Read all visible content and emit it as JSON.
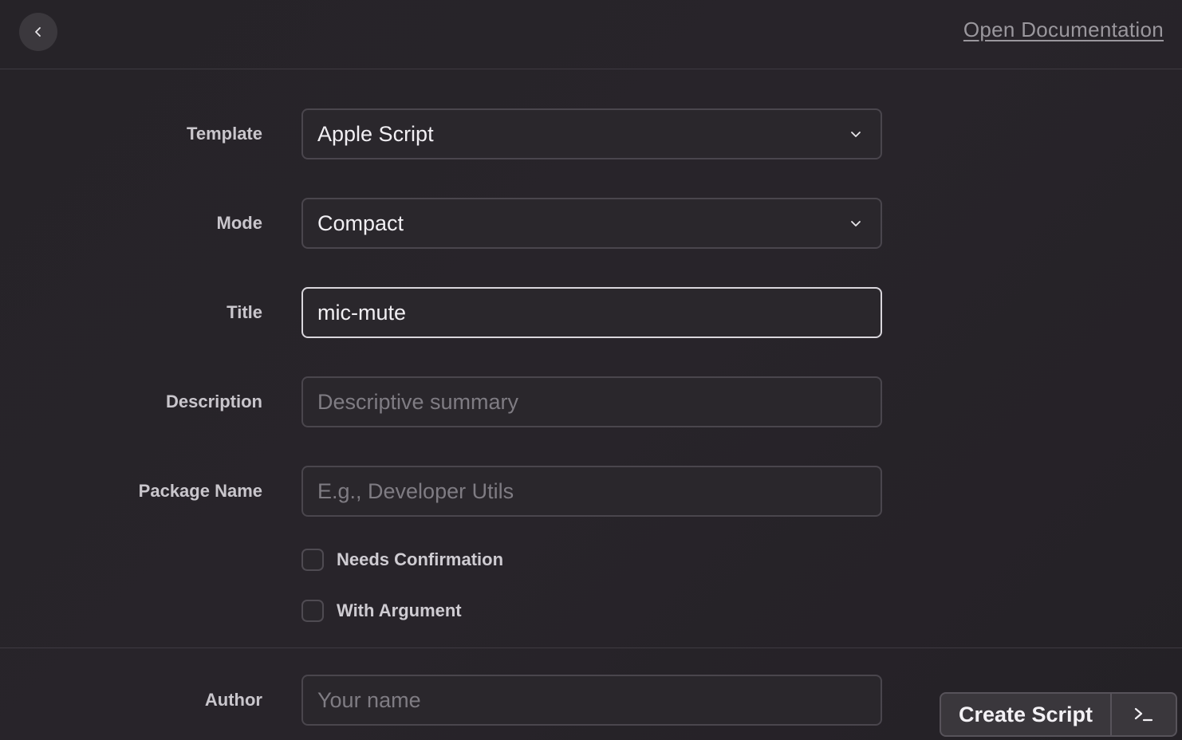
{
  "header": {
    "back_icon": "chevron-left-icon",
    "doc_link": "Open Documentation"
  },
  "form": {
    "template": {
      "label": "Template",
      "value": "Apple Script"
    },
    "mode": {
      "label": "Mode",
      "value": "Compact"
    },
    "title": {
      "label": "Title",
      "value": "mic-mute"
    },
    "description": {
      "label": "Description",
      "placeholder": "Descriptive summary"
    },
    "package_name": {
      "label": "Package Name",
      "placeholder": "E.g., Developer Utils"
    },
    "needs_confirmation": {
      "label": "Needs Confirmation",
      "checked": false
    },
    "with_argument": {
      "label": "With Argument",
      "checked": false
    },
    "author": {
      "label": "Author",
      "placeholder": "Your name"
    }
  },
  "actions": {
    "create_label": "Create Script",
    "terminal_icon": "terminal-icon"
  },
  "colors": {
    "background": "#252227",
    "field_border": "#4a464d",
    "focused_border": "#d9d6dc",
    "muted_text": "#7f7c83"
  }
}
